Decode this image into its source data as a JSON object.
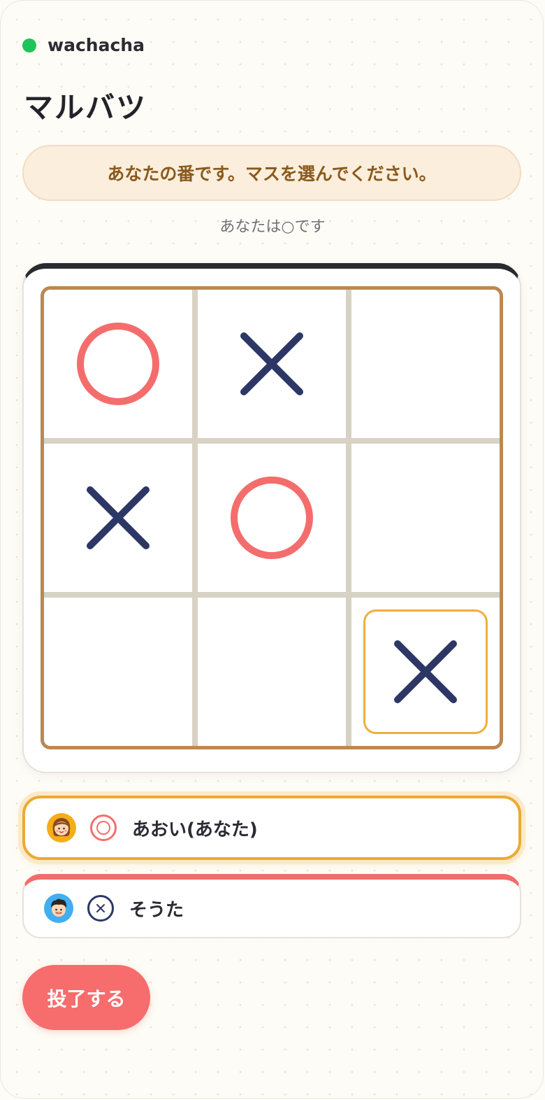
{
  "app": {
    "name": "wachacha",
    "status": "online"
  },
  "page": {
    "title": "マルバツ"
  },
  "turn": {
    "message": "あなたの番です。マスを選んでください。",
    "role": "あなたは○です"
  },
  "board": {
    "cells": [
      "O",
      "X",
      "",
      "X",
      "O",
      "",
      "",
      "",
      "X"
    ],
    "last_move": 8
  },
  "players": [
    {
      "name": "あおい(あなた)",
      "mark": "O",
      "avatar": "girl-avatar",
      "active": true
    },
    {
      "name": "そうた",
      "mark": "X",
      "avatar": "boy-avatar",
      "active": false
    }
  ],
  "actions": {
    "resign_label": "投了する"
  },
  "colors": {
    "accent_o": "#f46d6d",
    "accent_x": "#2d3766",
    "board_frame": "#bb8853",
    "highlight": "#f0ae3c",
    "online": "#1fc35a"
  }
}
